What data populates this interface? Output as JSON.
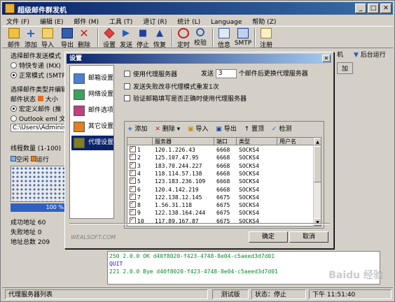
{
  "window": {
    "title": "超级邮件群发机"
  },
  "menu": [
    "文件 (F)",
    "编辑 (E)",
    "邮件 (M)",
    "工具 (T)",
    "退订 (R)",
    "统计 (L)",
    "Language",
    "帮助 (Z)"
  ],
  "toolbar": [
    "邮件",
    "添加",
    "导入",
    "导出",
    "删除",
    "设置",
    "发送",
    "停止",
    "恢复",
    "定时",
    "校验",
    "信息",
    "SMTP",
    "注册"
  ],
  "right_toolbar": {
    "item1": "机",
    "item2": "后台运行",
    "add": "加"
  },
  "left": {
    "mode_title": "选择邮件发送模式",
    "mode1": "特快专递 (MX)",
    "mode2": "正常模式 (SMTP)",
    "type_title": "选择邮件类型并编辑",
    "status_label": "邮件状态",
    "status_value": "大小",
    "custom": "宏定义邮件 (推",
    "outlook": "Outlook eml 文",
    "path": "C:\\Users\\Adminis",
    "threads": "线程数量 (1-100)",
    "legend_idle": "空闲",
    "legend_run": "运行",
    "progress": "100 %",
    "success": "成功地址  60",
    "fail": "失败地址  0",
    "total": "地址总数  209"
  },
  "log": [
    "250 2.0.0 OK d40f8020-f423-4748-8e04-c5aeed3d7d01",
    "QUIT",
    "221 2.0.0 Bye d40f8020-f423-4748-8e04-c5aeed3d7d01"
  ],
  "statusbar": {
    "left": "代理服务器列表",
    "mid": "测试版",
    "state": "状态：停止",
    "time": "下午 11:51:40"
  },
  "dialog": {
    "title": "设置",
    "nav": [
      "邮箱设置",
      "网络设置",
      "邮件选项",
      "其它设置",
      "代理设置"
    ],
    "use_proxy": "使用代理服务器",
    "send": "发送",
    "count": "3",
    "after": "个邮件后更换代理服务器",
    "retry": "发送失败改非代理模式重发1次",
    "verify": "验证邮箱填写是否正确时使用代理服务器",
    "ptools": [
      "添加",
      "删除",
      "导入",
      "导出",
      "置顶",
      "检测"
    ],
    "headers": [
      "服务器",
      "端口",
      "类型",
      "用户名"
    ],
    "rows": [
      [
        "1",
        "120.1.226.43",
        "6668",
        "SOCKS4"
      ],
      [
        "2",
        "125.107.47.95",
        "6668",
        "SOCKS4"
      ],
      [
        "3",
        "183.70.244.227",
        "6668",
        "SOCKS4"
      ],
      [
        "4",
        "118.114.57.138",
        "6668",
        "SOCKS4"
      ],
      [
        "5",
        "123.183.236.109",
        "6668",
        "SOCKS4"
      ],
      [
        "6",
        "120.4.142.219",
        "6668",
        "SOCKS4"
      ],
      [
        "7",
        "122.138.12.145",
        "6675",
        "SOCKS4"
      ],
      [
        "8",
        "1.56.31.118",
        "6675",
        "SOCKS4"
      ],
      [
        "9",
        "122.138.164.244",
        "6675",
        "SOCKS4"
      ],
      [
        "10",
        "117.89.167.87",
        "6675",
        "SOCKS4"
      ]
    ],
    "brand": "WEALSOFT.COM",
    "ok": "确定",
    "cancel": "取消"
  },
  "watermark": "Baidu 经验"
}
